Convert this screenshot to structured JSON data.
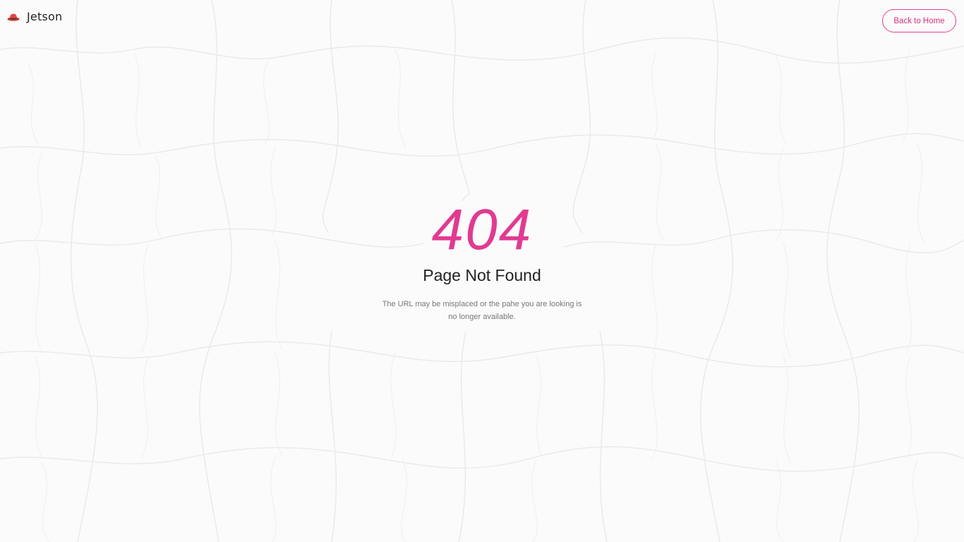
{
  "header": {
    "brand_name": "Jetson",
    "logo_icon": "hat-icon",
    "back_button_label": "Back to Home"
  },
  "error": {
    "code": "404",
    "title": "Page Not Found",
    "description": "The URL may be misplaced or the pahe you are looking is no longer available."
  },
  "colors": {
    "accent": "#e23a91",
    "background": "#fbfbfb",
    "crack_lines": "#e9e9e9",
    "logo": "#d9423f"
  }
}
